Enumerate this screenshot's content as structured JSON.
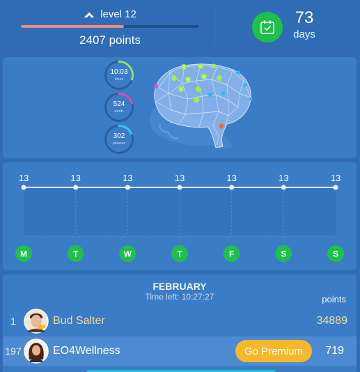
{
  "header": {
    "level_label": "level 12",
    "level_progress_percent": 58,
    "points_label": "2407 points",
    "days_count": "73",
    "days_label": "days"
  },
  "stats": [
    {
      "value": "10:03",
      "label": "hours",
      "progress": 0.3,
      "color": "#8fe36a"
    },
    {
      "value": "524",
      "label": "words",
      "progress": 0.2,
      "color": "#d64fb0"
    },
    {
      "value": "302",
      "label": "phrases",
      "progress": 0.18,
      "color": "#36c6f0"
    }
  ],
  "week": {
    "values": [
      "13",
      "13",
      "13",
      "13",
      "13",
      "13",
      "13"
    ],
    "days": [
      "M",
      "T",
      "W",
      "T",
      "F",
      "S",
      "S"
    ]
  },
  "leaderboard": {
    "month": "FEBRUARY",
    "time_left": "Time left: 10:27:27",
    "points_header": "points",
    "rows": [
      {
        "rank": "1",
        "name": "Bud Salter",
        "score": "34889"
      },
      {
        "rank": "197",
        "name": "EO4Wellness",
        "score": "719",
        "action": "Go Premium"
      }
    ]
  },
  "colors": {
    "background": "#2f6cb5",
    "card": "#3a7cc6",
    "accent_green": "#1fbf4c",
    "premium_button": "#f5b82a",
    "progress_fill": "#e98a7e"
  }
}
